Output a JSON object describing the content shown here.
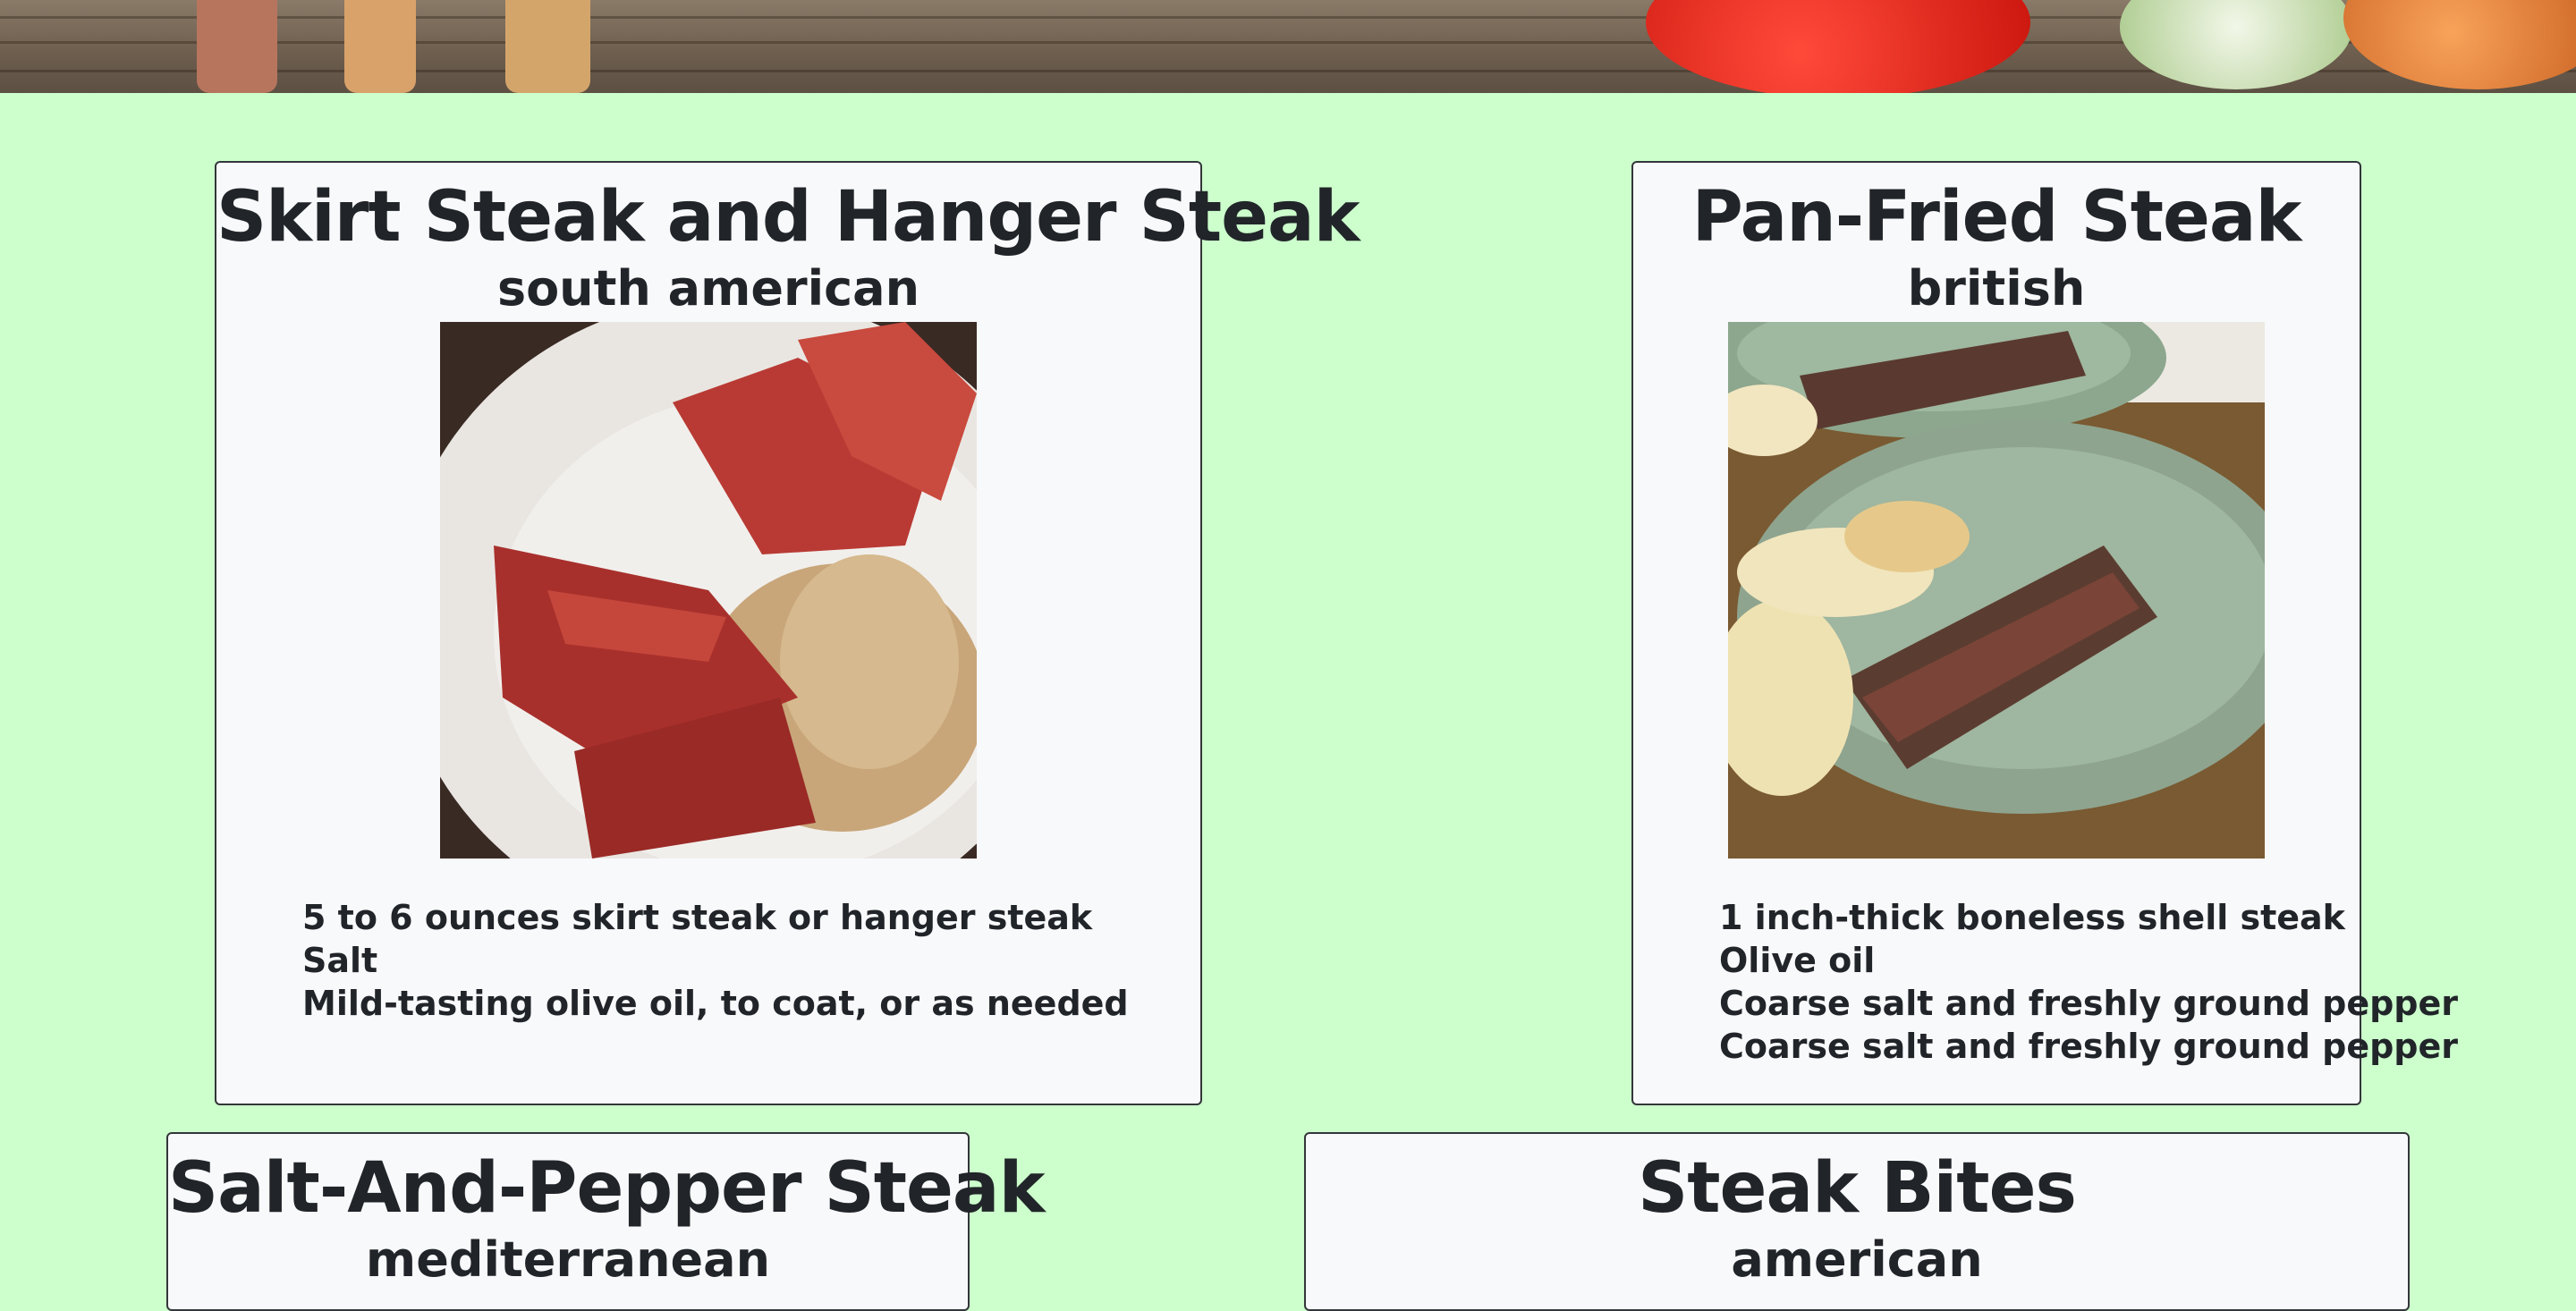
{
  "cards": [
    {
      "title": "Skirt Steak and Hanger Steak",
      "cuisine": "south american",
      "ingredients": [
        "5 to 6 ounces skirt steak or hanger steak",
        "Salt",
        "Mild-tasting olive oil, to coat, or as needed"
      ]
    },
    {
      "title": "Pan-Fried Steak",
      "cuisine": "british",
      "ingredients": [
        "1 inch-thick boneless shell steak",
        "Olive oil",
        "Coarse salt and freshly ground pepper",
        "Coarse salt and freshly ground pepper"
      ]
    },
    {
      "title": "Salt-And-Pepper Steak",
      "cuisine": "mediterranean"
    },
    {
      "title": "Steak Bites",
      "cuisine": "american"
    }
  ],
  "colors": {
    "page_background": "#ccffcc",
    "card_background": "#f8f9fb",
    "card_border": "#33363a",
    "text": "#212529"
  }
}
